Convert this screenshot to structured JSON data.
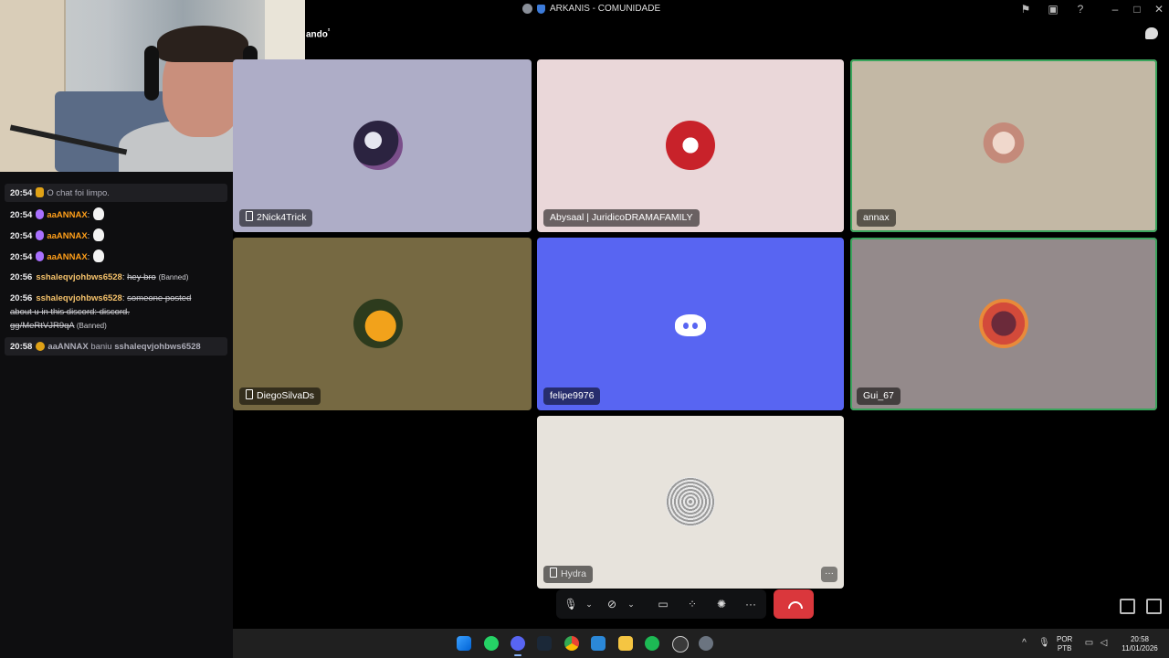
{
  "window": {
    "title": "ARKANIS - COMUNIDADE",
    "channel_partial": "ando",
    "channel_superscript": "²"
  },
  "chat": {
    "messages": [
      {
        "time": "20:54",
        "type": "system",
        "badge": "trash-icon",
        "text": "O chat foi limpo."
      },
      {
        "time": "20:54",
        "user": "aaANNAX",
        "badge": "mic-badge",
        "emote": "duck-emote"
      },
      {
        "time": "20:54",
        "user": "aaANNAX",
        "badge": "mic-badge",
        "emote": "duck-emote"
      },
      {
        "time": "20:54",
        "user": "aaANNAX",
        "badge": "mic-badge",
        "emote": "duck-emote"
      },
      {
        "time": "20:56",
        "user": "sshaleqvjohbws6528",
        "text": "hey bro",
        "status": "(Banned)"
      },
      {
        "time": "20:56",
        "user": "sshaleqvjohbws6528",
        "text_line1": "someone posted",
        "text_line2": "about u in this discord: discord.",
        "text_line3": "gg/MeRtVJR9qA",
        "status": "(Banned)"
      },
      {
        "time": "20:58",
        "type": "system",
        "badge": "shield-icon",
        "actor": "aaANNAX",
        "action": "baniu",
        "target": "sshaleqvjohbws6528"
      }
    ],
    "separator": ":"
  },
  "participants": [
    {
      "name": "2Nick4Trick",
      "mobile": true,
      "bg": "#aeadc7"
    },
    {
      "name": "Abysaal | JuridicoDRAMAFAMILY",
      "mobile": false,
      "bg": "#ead7d9"
    },
    {
      "name": "annax",
      "mobile": false,
      "bg": "#c3b8a5",
      "speaking": true
    },
    {
      "name": "DiegoSilvaDs",
      "mobile": true,
      "bg": "#766942"
    },
    {
      "name": "felipe9976",
      "mobile": false,
      "bg": "#5865f2"
    },
    {
      "name": "Gui_67",
      "mobile": false,
      "bg": "#948a8b",
      "speaking": true
    },
    {
      "name": "Hydra",
      "mobile": true,
      "bg": "#e7e3dc"
    }
  ],
  "controls": {
    "more_label": "···"
  },
  "taskbar": {
    "lang_line1": "POR",
    "lang_line2": "PTB",
    "time": "20:58",
    "date": "11/01/2026"
  },
  "colors": {
    "accent": "#5865f2",
    "hangup": "#da373c",
    "speaking": "#3ba55d",
    "chat_user": "#ff9f1a"
  }
}
